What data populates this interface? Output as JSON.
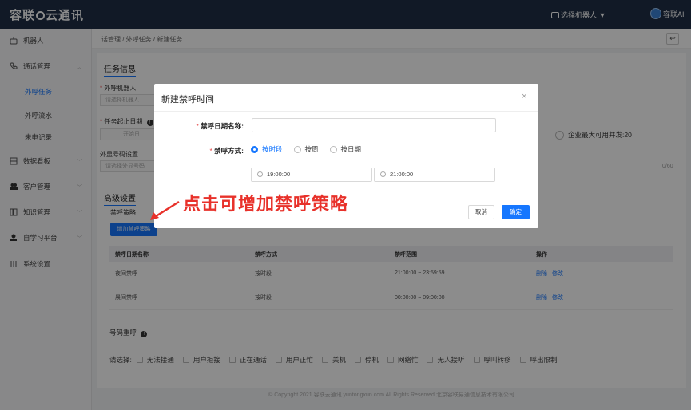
{
  "topbar": {
    "logo_left": "容联",
    "logo_right": "云通讯",
    "robot_select": "选择机器人 ▼",
    "user_name": "容联AI"
  },
  "sidebar": {
    "items": [
      {
        "label": "机器人"
      },
      {
        "label": "通话管理"
      },
      {
        "label": "外呼任务"
      },
      {
        "label": "外呼流水"
      },
      {
        "label": "来电记录"
      },
      {
        "label": "数据看板"
      },
      {
        "label": "客户管理"
      },
      {
        "label": "知识管理"
      },
      {
        "label": "自学习平台"
      },
      {
        "label": "系统设置"
      }
    ]
  },
  "breadcrumb": {
    "text": "话管理 / 外呼任务 / 新建任务",
    "back": "↩"
  },
  "form": {
    "section_task": "任务信息",
    "robot_label": "外呼机器人",
    "robot_placeholder": "请选择机器人",
    "date_label": "任务起止日期",
    "date_placeholder": "开始日",
    "number_label": "外显号码设置",
    "number_placeholder": "请选择外显号码",
    "concurrency_note": "企业最大可用并发:20",
    "counter": "0/60",
    "section_advanced": "高级设置",
    "strategy_label": "禁呼策略",
    "add_strategy": "增加禁呼策略"
  },
  "table": {
    "headers": [
      "禁呼日期名称",
      "禁呼方式",
      "禁呼范围",
      "操作"
    ],
    "rows": [
      {
        "name": "夜间禁呼",
        "mode": "按时段",
        "range": "21:00:00 ~ 23:59:59",
        "op_delete": "删除",
        "op_edit": "修改"
      },
      {
        "name": "晨间禁呼",
        "mode": "按时段",
        "range": "00:00:00 ~ 09:00:00",
        "op_delete": "删除",
        "op_edit": "修改"
      }
    ]
  },
  "redial": {
    "title": "号码重呼",
    "prefix": "请选择:",
    "options": [
      "无法接通",
      "用户拒接",
      "正在通话",
      "用户正忙",
      "关机",
      "停机",
      "网络忙",
      "无人接听",
      "呼叫转移",
      "呼出限制"
    ]
  },
  "footer": "© Copyright 2021   容联云通讯   yuntongxun.com   All Rights Reserved   北京容联易通信息技术有限公司",
  "modal": {
    "title": "新建禁呼时间",
    "close": "×",
    "name_label": "禁呼日期名称:",
    "mode_label": "禁呼方式:",
    "modes": [
      "按时段",
      "按周",
      "按日期"
    ],
    "selected_mode": "按时段",
    "start_time": "19:00:00",
    "end_time": "21:00:00",
    "cancel": "取消",
    "ok": "确定"
  },
  "annotation": "点击可增加禁呼策略",
  "colors": {
    "accent": "#1677ff",
    "topbar": "#1f2e45",
    "annotation": "#e8312a"
  }
}
